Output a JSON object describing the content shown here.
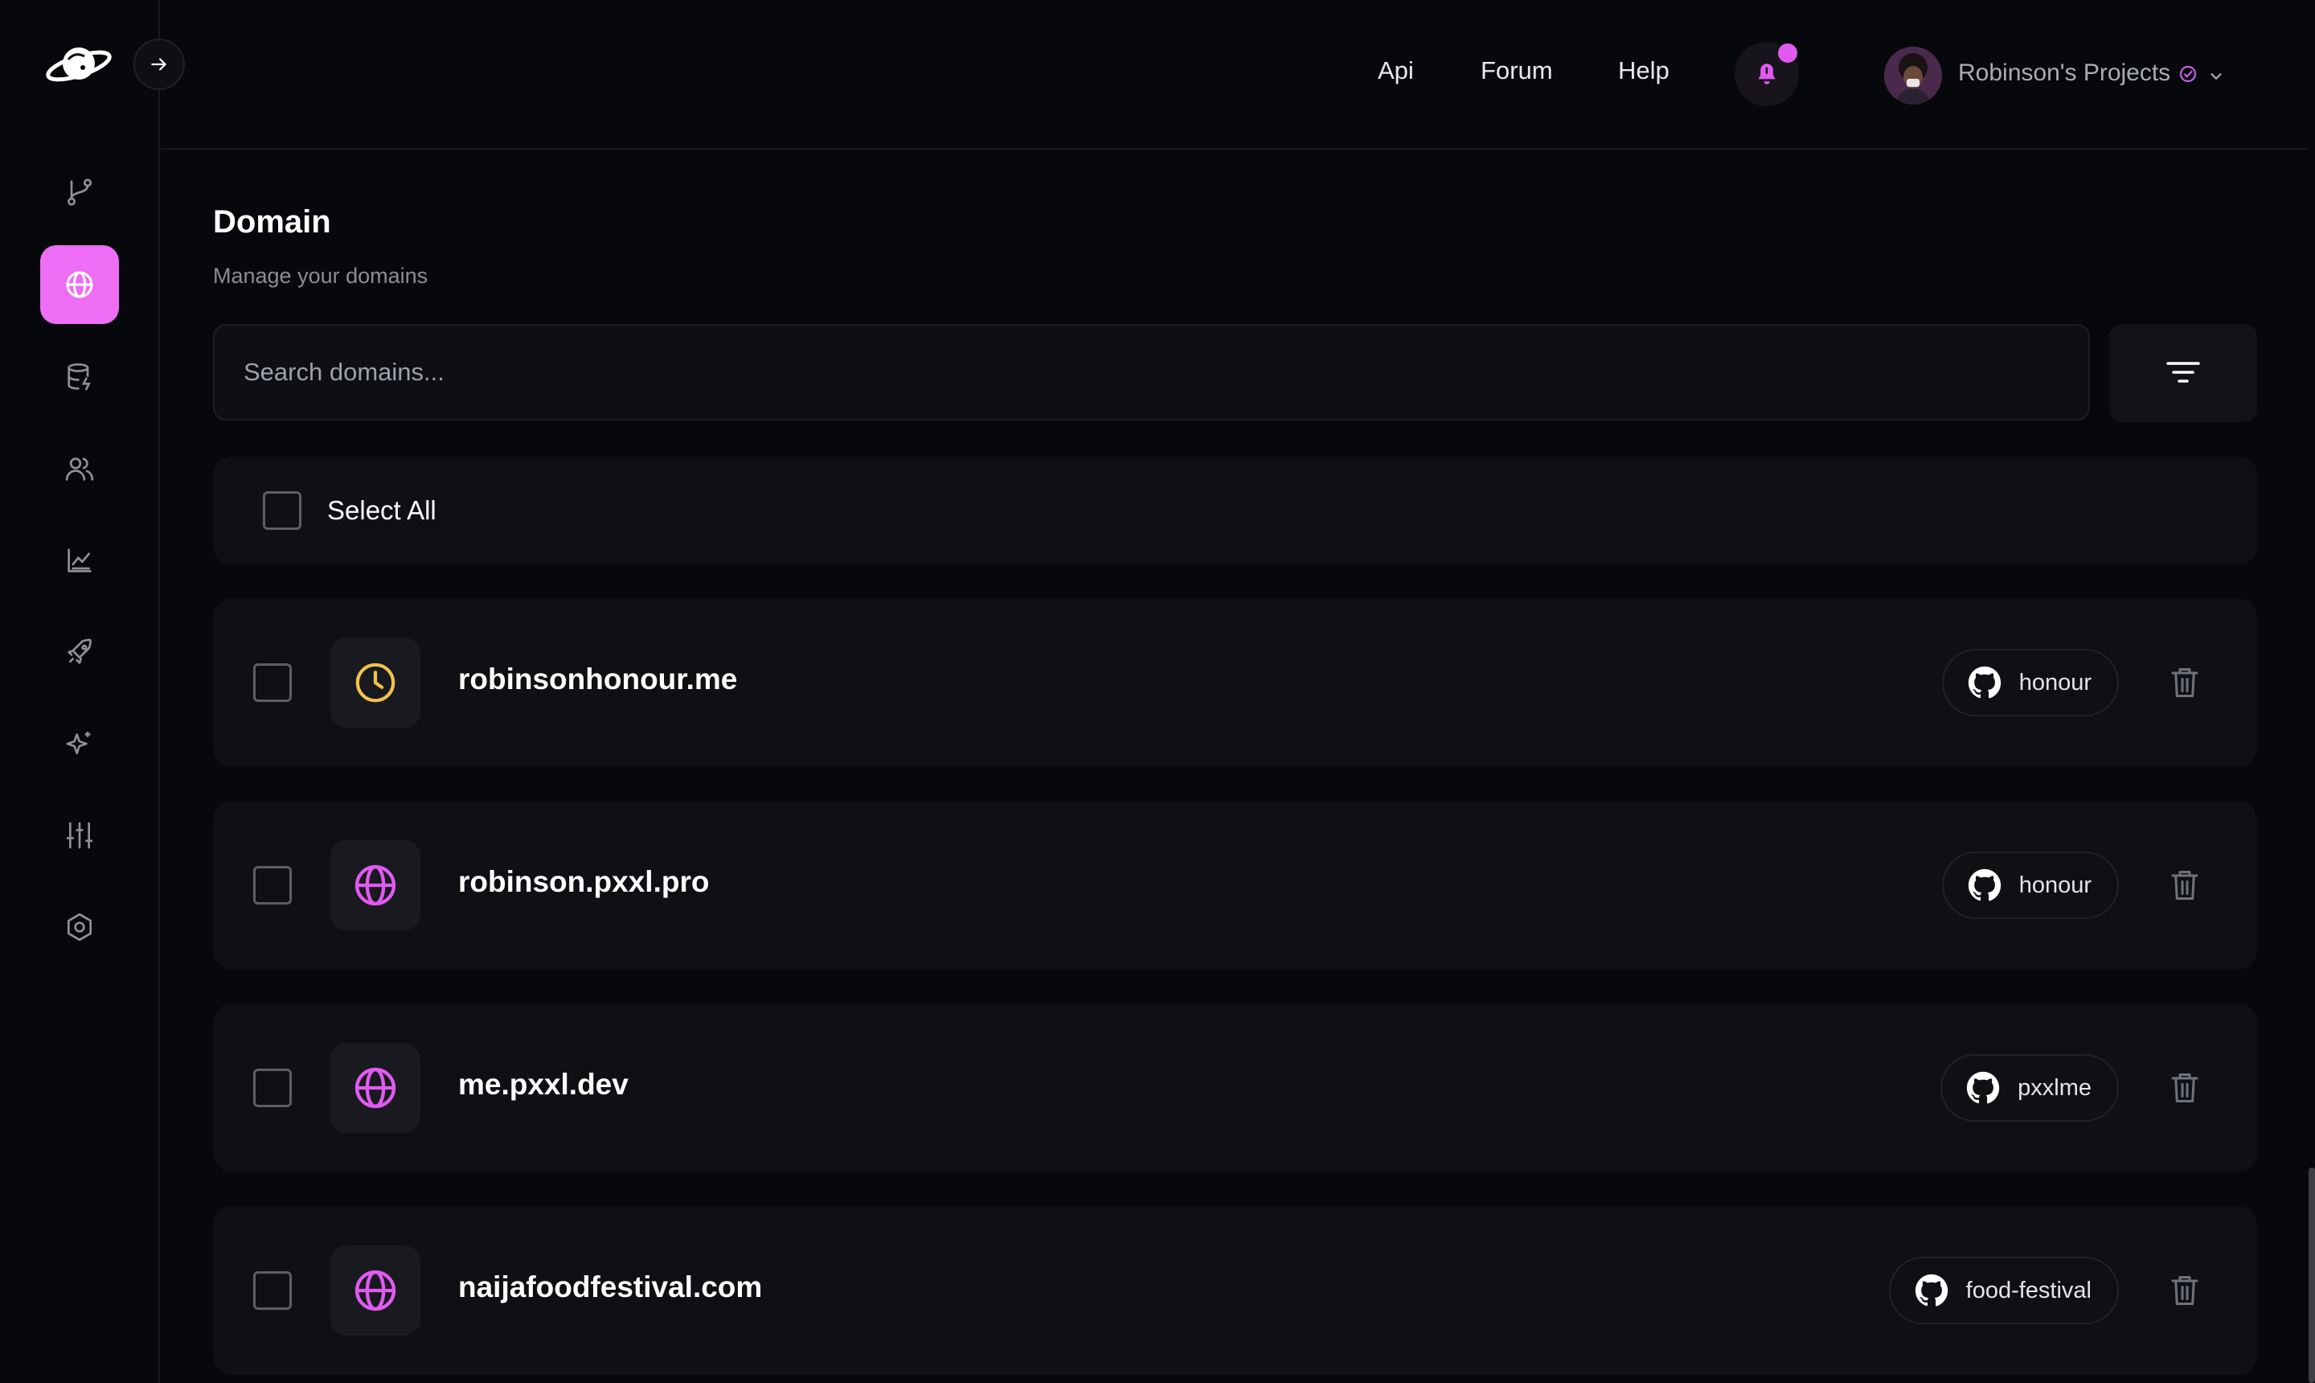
{
  "header": {
    "nav": [
      {
        "label": "Api"
      },
      {
        "label": "Forum"
      },
      {
        "label": "Help"
      }
    ],
    "project_name": "Robinson's Projects",
    "accent": "#ee6df5"
  },
  "sidebar": {
    "items": [
      {
        "icon": "git-branch-icon"
      },
      {
        "icon": "globe-icon",
        "active": true
      },
      {
        "icon": "database-icon"
      },
      {
        "icon": "users-icon"
      },
      {
        "icon": "analytics-chart-icon"
      },
      {
        "icon": "rocket-icon"
      },
      {
        "icon": "sparkle-icon"
      },
      {
        "icon": "sliders-icon"
      },
      {
        "icon": "settings-hexagon-icon"
      }
    ]
  },
  "main": {
    "title": "Domain",
    "subtitle": "Manage your domains",
    "search_placeholder": "Search domains...",
    "select_all_label": "Select All",
    "domains": [
      {
        "name": "robinsonhonour.me",
        "status_icon": "clock-icon",
        "repo": "honour"
      },
      {
        "name": "robinson.pxxl.pro",
        "status_icon": "globe-icon",
        "repo": "honour"
      },
      {
        "name": "me.pxxl.dev",
        "status_icon": "globe-icon",
        "repo": "pxxlme"
      },
      {
        "name": "naijafoodfestival.com",
        "status_icon": "globe-icon",
        "repo": "food-festival"
      }
    ]
  }
}
